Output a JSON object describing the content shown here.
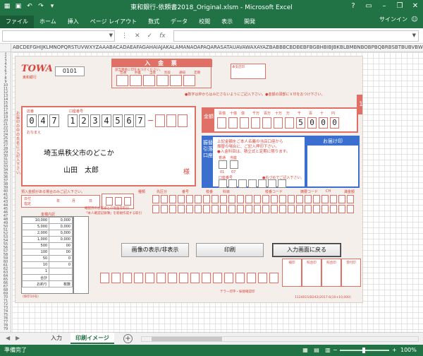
{
  "window": {
    "title": "東和銀行-依頼書2018_Original.xlsm - Microsoft Excel",
    "signin": "サインイン"
  },
  "ribbon": {
    "tabs": [
      "ファイル",
      "ホーム",
      "挿入",
      "ページ レイアウト",
      "数式",
      "データ",
      "校閲",
      "表示",
      "開発"
    ]
  },
  "formula_bar": {
    "name_box": "",
    "fx": "fx",
    "content": ""
  },
  "columns": "ABCDEFGHIJKLMNOPQRSTUVWXYZAAABACADAEAFAGAHAIAJAKALAMANAOAPAQARASATAUAVAWAXAYAZBABBBCBDBEBFBGBHBIBJBKBLBMBNBOBPBQBRBSBTBUBVBWBXBYBZCACBCCCDCECF",
  "slip": {
    "logo": "TOWA",
    "logo_sub": "東和銀行",
    "code": "0101",
    "header_title": "入 金 票",
    "header_note": "該当預金に印をおつけください。",
    "deposit_types": [
      "普通",
      "貯蓄",
      "当座",
      "別段",
      "通知",
      "定期"
    ],
    "inkan_label": "本支店印",
    "notice": "●数字は枠からはみださないようにご記入下さい。●金額の頭部に￥印をおつけ下さい。",
    "side_note": "お届印の中の氏名にご記入下さい。",
    "store_label": "店番",
    "account_label": "口座番号",
    "name_label": "おなまえ",
    "store_number": [
      "0",
      "4",
      "7"
    ],
    "account_number": [
      "1",
      "2",
      "3",
      "4",
      "5",
      "6",
      "7"
    ],
    "dash": "−",
    "address": "埼玉県秩父市のどこか",
    "customer_name": "山田　太郎",
    "honorific": "様",
    "kingaku_label": "金額",
    "amount_units": [
      "百億",
      "十億",
      "億",
      "千万",
      "百万",
      "十万",
      "万",
      "千",
      "百",
      "十",
      "円"
    ],
    "amount_digits": [
      "",
      "",
      "",
      "",
      "",
      "",
      "",
      "5",
      "0",
      "0",
      "0"
    ],
    "yen": "円",
    "side_tab": "1",
    "furikae_label": "振替引落口座",
    "furikae_text": [
      "上記金額をご本人名義の当店口座から",
      "振替の場合に、ご記入押印下さい。",
      "●入金科目は、積立式と定期に限ります。"
    ],
    "furikae_opts": [
      "普通",
      "当座",
      "01",
      "07",
      "口座番号"
    ],
    "furikae_note": "●右づめでご記入下さい。",
    "otodoke": "お届け印",
    "row2_note": "預入金額がある場合のみご記入下さい。",
    "row2_labels": [
      "日付",
      "指定",
      "年",
      "月",
      "日"
    ],
    "row2_heads": [
      "種類",
      "先区分",
      "番号",
      "枝番",
      "科目",
      "枝番コード",
      "摘要コード",
      "CH",
      "満金額"
    ],
    "kinshu_title": "金種内訳",
    "kinshu_rows": [
      [
        "10,000",
        "0,000"
      ],
      [
        "5,000",
        "0,000"
      ],
      [
        "2,000",
        "0,000"
      ],
      [
        "1,000",
        "0,000"
      ],
      [
        "500",
        "00"
      ],
      [
        "100",
        "00"
      ],
      [
        "50",
        "0"
      ],
      [
        "10",
        "0"
      ],
      [
        "1",
        ""
      ],
      [
        "合計",
        ""
      ],
      [
        "お釣り",
        "枚数"
      ]
    ],
    "confirm_note": [
      "確認済のお客様との現金等取引",
      "「本人確認記録簿」を新規作成する取引"
    ],
    "stamps": [
      "検印",
      "照合印",
      "照合印",
      "受付印"
    ],
    "foot_code": "1124015(B242)2017.6(10+10,000)",
    "foot_label": "テラー印字・振替確認印",
    "kakari": "(係印10号)"
  },
  "buttons": {
    "toggle_image": "画像の表示/非表示",
    "print": "印刷",
    "back_to_input": "入力画面に戻る"
  },
  "sheets": {
    "tabs": [
      "入力",
      "印刷イメージ"
    ],
    "active": "印刷イメージ"
  },
  "status": {
    "ready": "準備完了",
    "zoom": "100%",
    "zoom_minus": "−",
    "zoom_plus": "+"
  }
}
